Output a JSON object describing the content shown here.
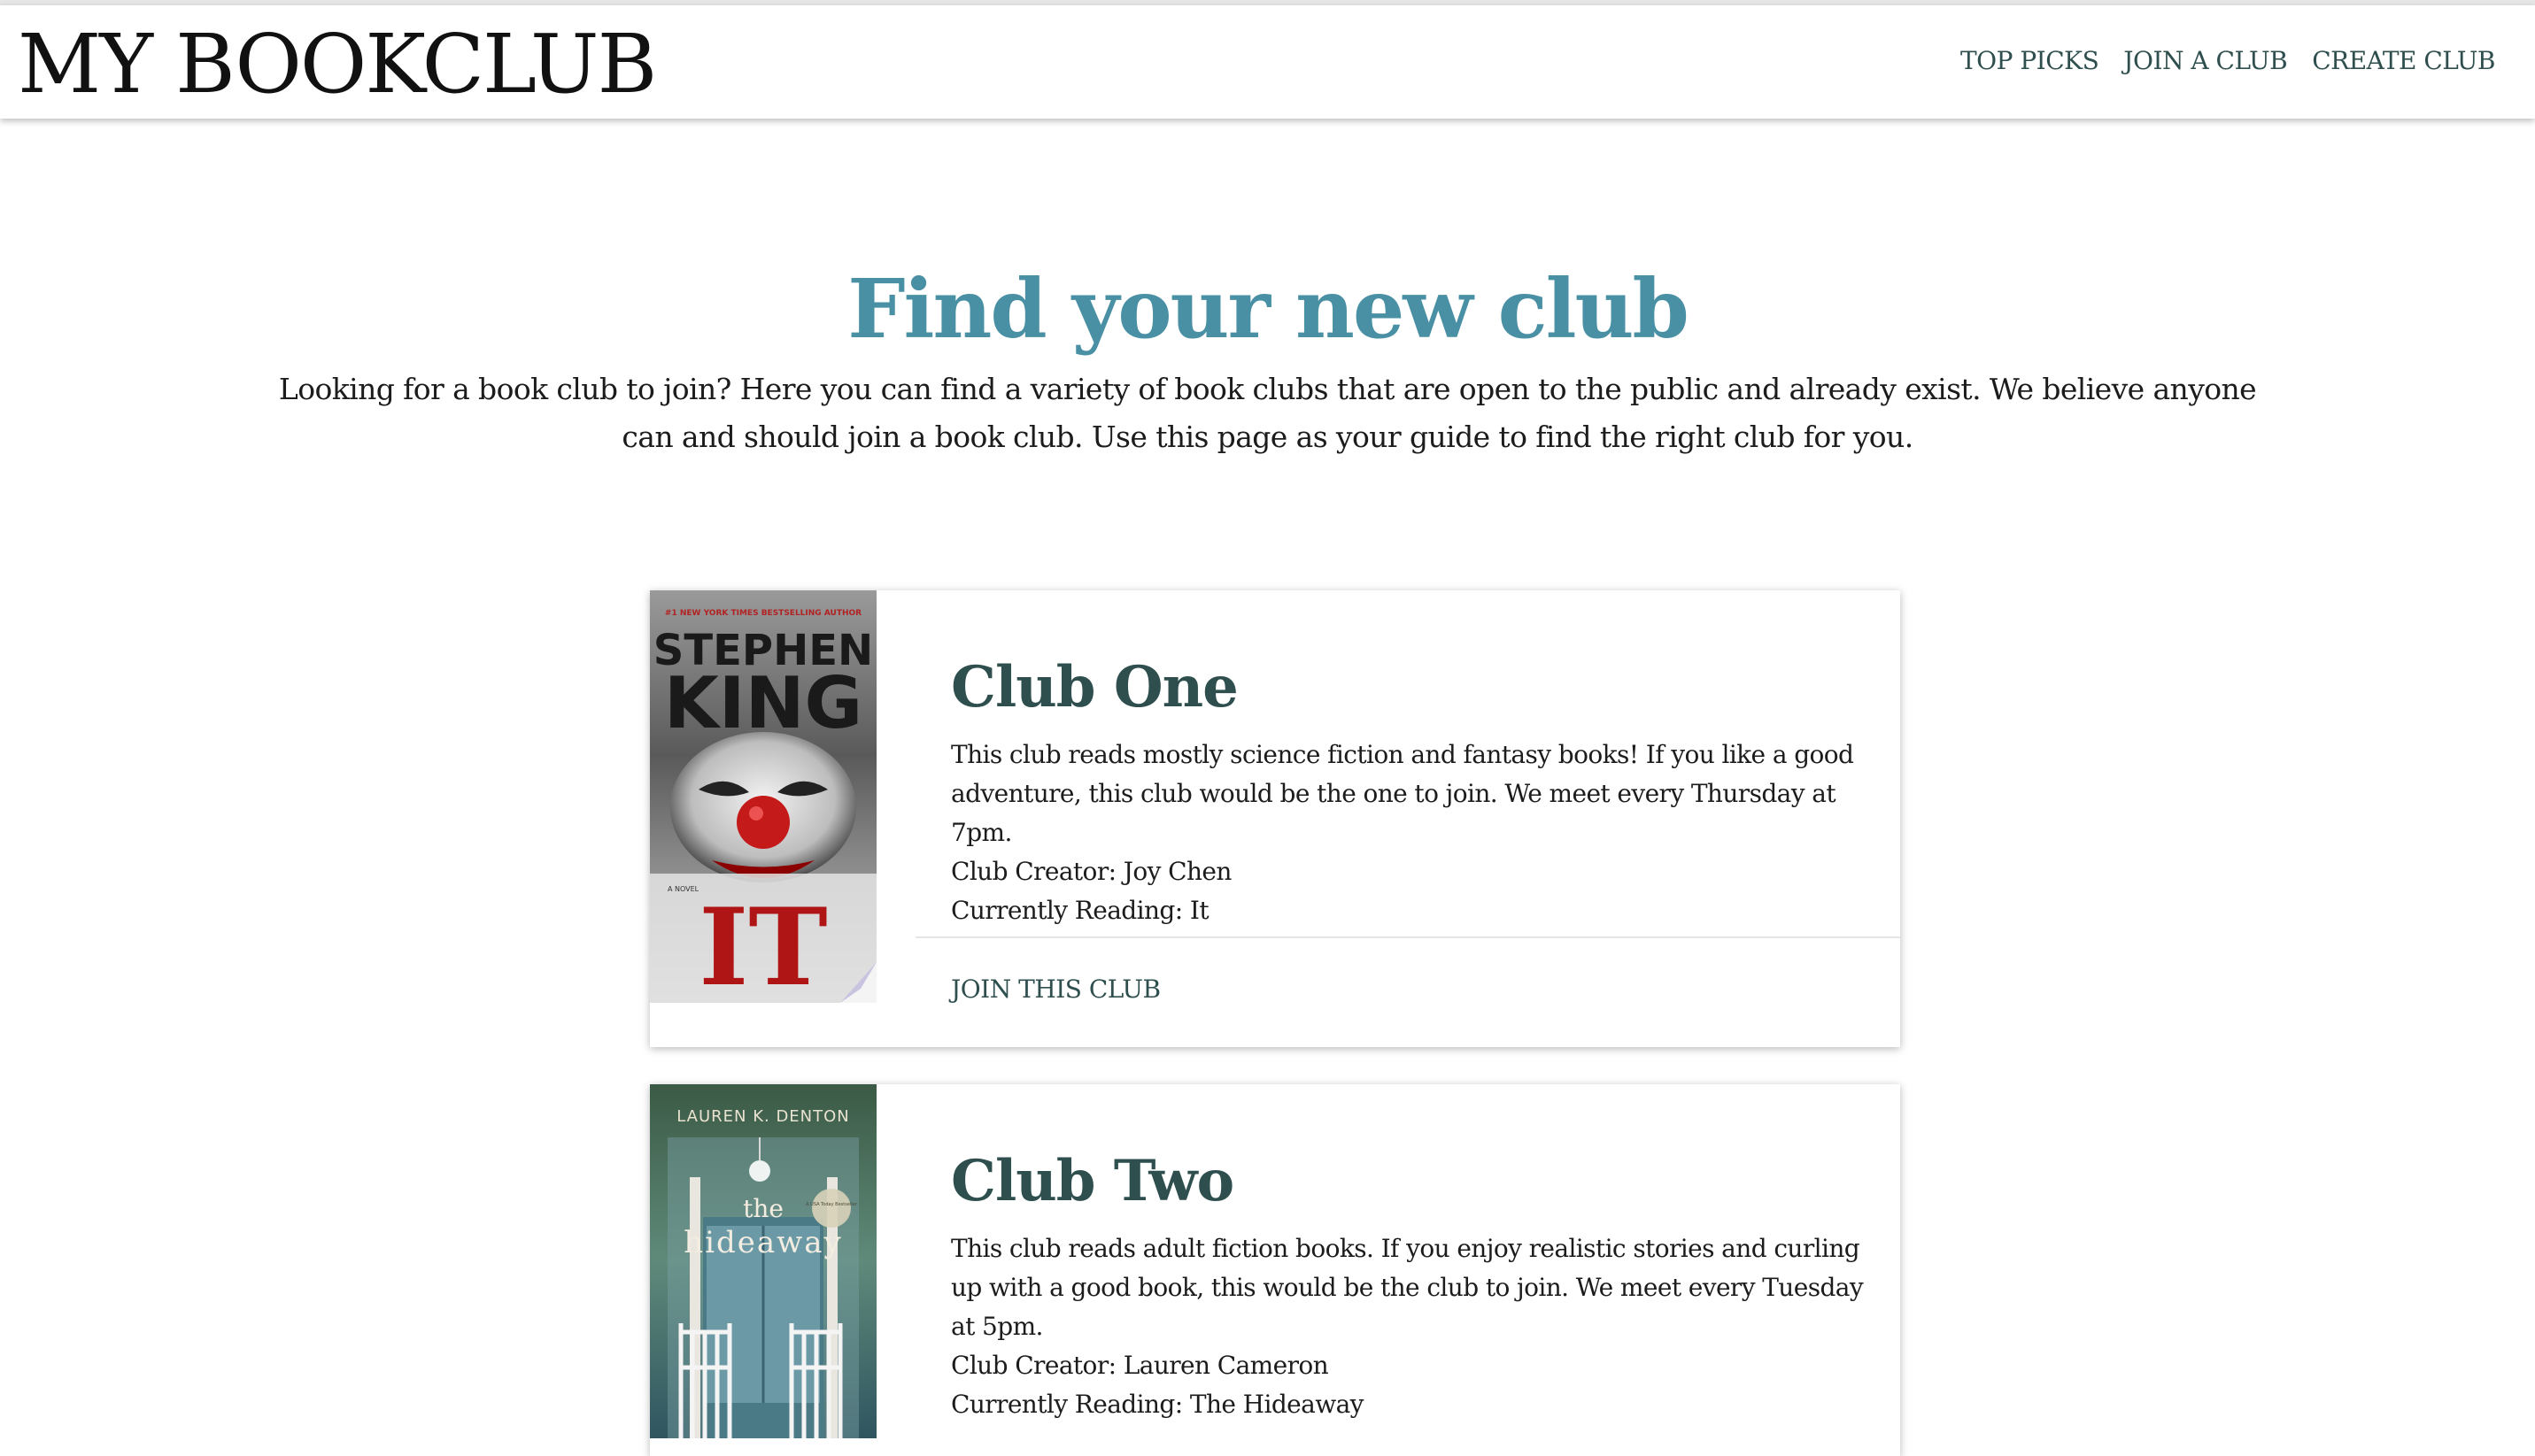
{
  "header": {
    "brand": "MY BOOKCLUB",
    "nav": [
      "TOP PICKS",
      "JOIN A CLUB",
      "CREATE CLUB"
    ]
  },
  "hero": {
    "title": "Find your new club",
    "text": "Looking for a book club to join? Here you can find a variety of book clubs that are open to the public and already exist. We believe anyone can and should join a book club. Use this page as your guide to find the right club for you."
  },
  "clubs": [
    {
      "name": "Club One",
      "description": "This club reads mostly science fiction and fantasy books! If you like a good adventure, this club would be the one to join. We meet every Thursday at 7pm.",
      "creator": "Club Creator: Joy Chen",
      "reading": "Currently Reading: It",
      "action": "JOIN THIS CLUB",
      "cover": {
        "tagline": "#1 NEW YORK TIMES BESTSELLING AUTHOR",
        "author_line1": "STEPHEN",
        "author_line2": "KING",
        "title": "IT",
        "subtitle": "A NOVEL"
      }
    },
    {
      "name": "Club Two",
      "description": "This club reads adult fiction books. If you enjoy realistic stories and curling up with a good book, this would be the club to join. We meet every Tuesday at 5pm.",
      "creator": "Club Creator: Lauren Cameron",
      "reading": "Currently Reading: The Hideaway",
      "cover": {
        "author": "LAUREN K. DENTON",
        "title_small": "the",
        "title_big": "hideaway",
        "badge": "A USA Today Bestseller"
      }
    }
  ],
  "colors": {
    "accent_teal": "#4a90a4",
    "dark_slate": "#2f4f4f"
  }
}
